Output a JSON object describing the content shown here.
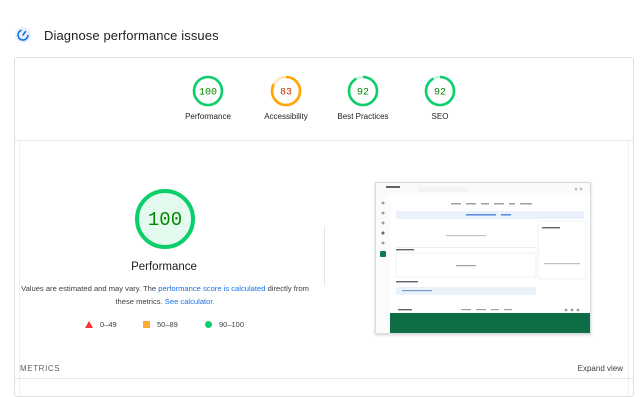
{
  "section": {
    "title": "Diagnose performance issues"
  },
  "colors": {
    "pass": "#0cce6b",
    "average": "#ffa400",
    "fail": "#ff4e42",
    "link": "#1a73e8"
  },
  "gauges": [
    {
      "score": "100",
      "label": "Performance",
      "value": 1.0,
      "status": "pass"
    },
    {
      "score": "83",
      "label": "Accessibility",
      "value": 0.83,
      "status": "average"
    },
    {
      "score": "92",
      "label": "Best Practices",
      "value": 0.92,
      "status": "pass"
    },
    {
      "score": "92",
      "label": "SEO",
      "value": 0.92,
      "status": "pass"
    }
  ],
  "main": {
    "score": "100",
    "value": 1.0,
    "title": "Performance",
    "desc_prefix": "Values are estimated and may vary. The ",
    "desc_link1": "performance score is calculated",
    "desc_mid": " directly from these metrics. ",
    "desc_link2": "See calculator."
  },
  "legend": {
    "fail": "0–49",
    "average": "50–89",
    "pass": "90–100"
  },
  "footer": {
    "metrics_label": "METRICS",
    "expand_label": "Expand view"
  }
}
